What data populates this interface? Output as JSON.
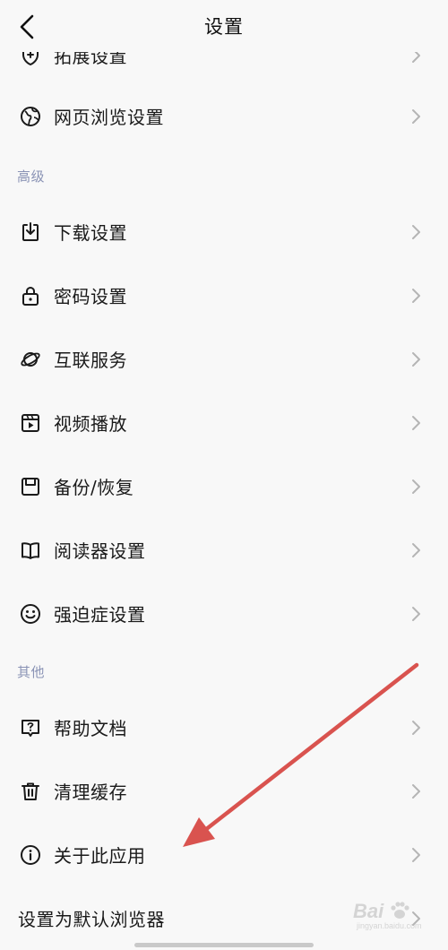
{
  "header": {
    "title": "设置",
    "back_icon": "chevron-left-icon"
  },
  "items_top": [
    {
      "label": "拓展设置",
      "icon": "shield-puzzle-icon"
    },
    {
      "label": "网页浏览设置",
      "icon": "globe-icon"
    }
  ],
  "section_advanced": {
    "title": "高级",
    "items": [
      {
        "label": "下载设置",
        "icon": "download-icon"
      },
      {
        "label": "密码设置",
        "icon": "lock-icon"
      },
      {
        "label": "互联服务",
        "icon": "planet-icon"
      },
      {
        "label": "视频播放",
        "icon": "video-play-icon"
      },
      {
        "label": "备份/恢复",
        "icon": "backup-icon"
      },
      {
        "label": "阅读器设置",
        "icon": "book-icon"
      },
      {
        "label": "强迫症设置",
        "icon": "smiley-icon"
      }
    ]
  },
  "section_other": {
    "title": "其他",
    "items": [
      {
        "label": "帮助文档",
        "icon": "help-document-icon"
      },
      {
        "label": "清理缓存",
        "icon": "trash-icon"
      },
      {
        "label": "关于此应用",
        "icon": "info-icon"
      },
      {
        "label": "设置为默认浏览器",
        "icon": ""
      }
    ]
  },
  "watermark": {
    "brand": "Bai",
    "sub": "jingyan.baidu.com"
  },
  "colors": {
    "background": "#f8f8f8",
    "section_title": "#8a93b5",
    "chevron": "#b5b5b5",
    "annotation_arrow": "#d9534f"
  }
}
